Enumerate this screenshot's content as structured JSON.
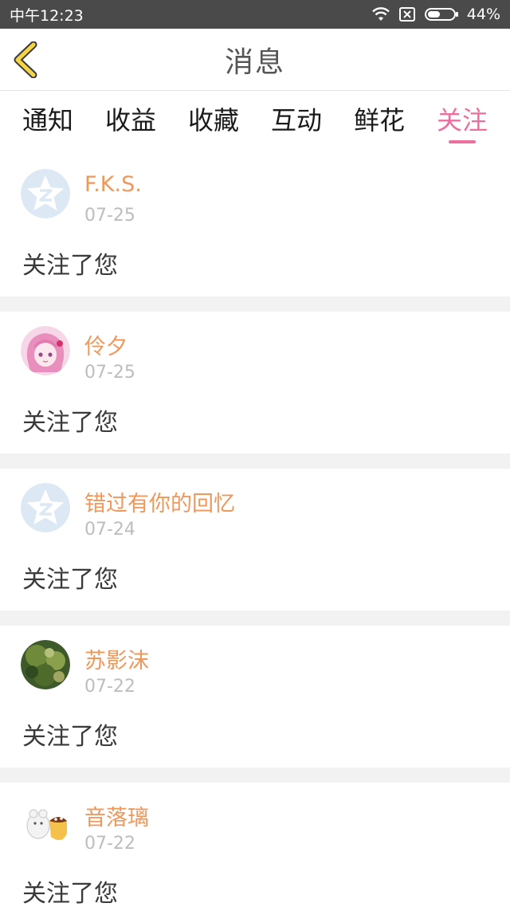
{
  "status_bar": {
    "time": "中午12:23",
    "battery": "44%"
  },
  "header": {
    "title": "消息"
  },
  "tabs": [
    {
      "label": "通知"
    },
    {
      "label": "收益"
    },
    {
      "label": "收藏"
    },
    {
      "label": "互动"
    },
    {
      "label": "鲜花"
    },
    {
      "label": "关注"
    }
  ],
  "active_tab": "关注",
  "colors": {
    "accent": "#ec6fa0",
    "username": "#f0975a",
    "date": "#bdbdbd"
  },
  "messages": [
    {
      "name": "F.K.S.",
      "date": "07-25",
      "text": "关注了您",
      "avatar": "default-avatar-icon"
    },
    {
      "name": "伶夕",
      "date": "07-25",
      "text": "关注了您",
      "avatar": "anime-girl-avatar"
    },
    {
      "name": "错过有你的回忆",
      "date": "07-24",
      "text": "关注了您",
      "avatar": "default-avatar-icon"
    },
    {
      "name": "苏影沫",
      "date": "07-22",
      "text": "关注了您",
      "avatar": "nature-photo-avatar"
    },
    {
      "name": "音落璃",
      "date": "07-22",
      "text": "关注了您",
      "avatar": "cartoon-animal-avatar"
    }
  ]
}
